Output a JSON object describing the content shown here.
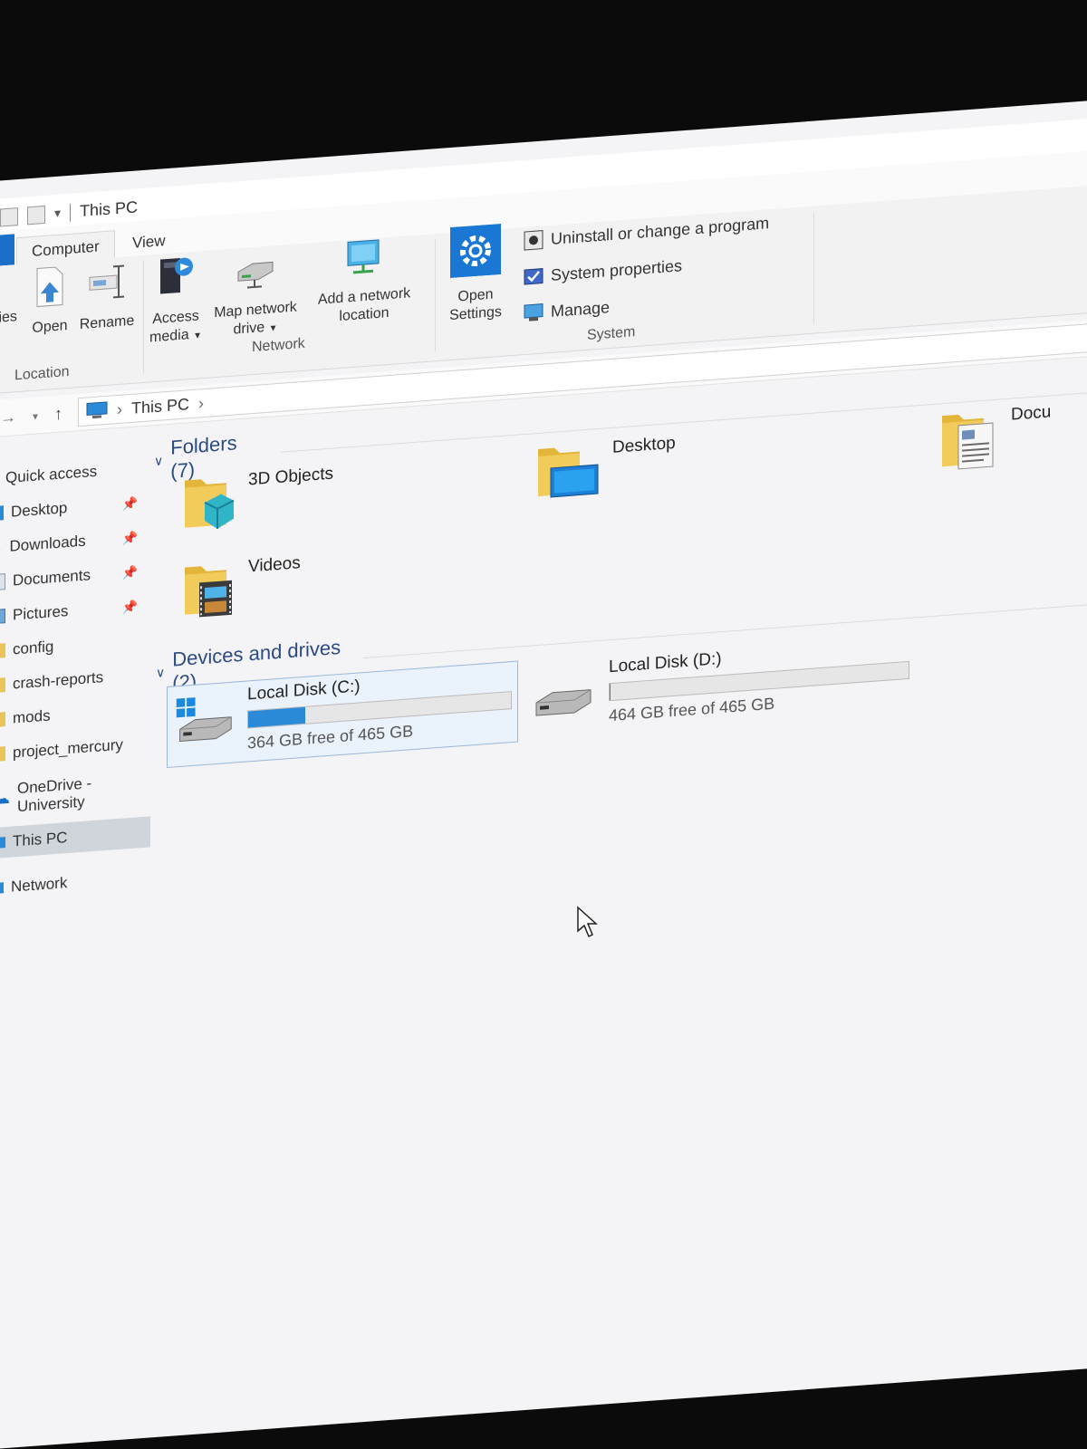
{
  "window": {
    "title": "This PC"
  },
  "tabs": [
    {
      "label": "Computer",
      "active": true
    },
    {
      "label": "View",
      "active": false
    }
  ],
  "ribbon": {
    "location": {
      "group_label": "Location",
      "partial_label": "ties",
      "open_label": "Open",
      "rename_label": "Rename"
    },
    "network": {
      "group_label": "Network",
      "access_media_line1": "Access",
      "access_media_line2": "media",
      "map_drive_line1": "Map network",
      "map_drive_line2": "drive",
      "add_location_line1": "Add a network",
      "add_location_line2": "location"
    },
    "settings": {
      "line1": "Open",
      "line2": "Settings"
    },
    "system": {
      "group_label": "System",
      "uninstall_label": "Uninstall or change a program",
      "properties_label": "System properties",
      "manage_label": "Manage"
    }
  },
  "address": {
    "path_item": "This PC"
  },
  "sidebar": {
    "items": [
      {
        "label": "Quick access",
        "pinned": false
      },
      {
        "label": "Desktop",
        "pinned": true
      },
      {
        "label": "Downloads",
        "pinned": true
      },
      {
        "label": "Documents",
        "pinned": true
      },
      {
        "label": "Pictures",
        "pinned": true
      },
      {
        "label": "config",
        "pinned": false
      },
      {
        "label": "crash-reports",
        "pinned": false
      },
      {
        "label": "mods",
        "pinned": false
      },
      {
        "label": "project_mercury",
        "pinned": false
      },
      {
        "label": "OneDrive - University",
        "pinned": false
      },
      {
        "label": "This PC",
        "pinned": false,
        "selected": true
      },
      {
        "label": "Network",
        "pinned": false
      }
    ]
  },
  "folders": {
    "header": "Folders (7)",
    "items": [
      {
        "label": "3D Objects"
      },
      {
        "label": "Desktop"
      },
      {
        "label": "Docu"
      },
      {
        "label": "Videos"
      }
    ]
  },
  "drives": {
    "header": "Devices and drives (2)",
    "items": [
      {
        "name": "Local Disk (C:)",
        "free_text": "364 GB free of 465 GB",
        "used_fraction": 0.217,
        "selected": true
      },
      {
        "name": "Local Disk (D:)",
        "free_text": "464 GB free of 465 GB",
        "used_fraction": 0.002,
        "selected": false
      }
    ]
  },
  "colors": {
    "accent": "#1a6fc8",
    "drive_bar": "#2a8ad8",
    "header_text": "#2b4a84"
  }
}
